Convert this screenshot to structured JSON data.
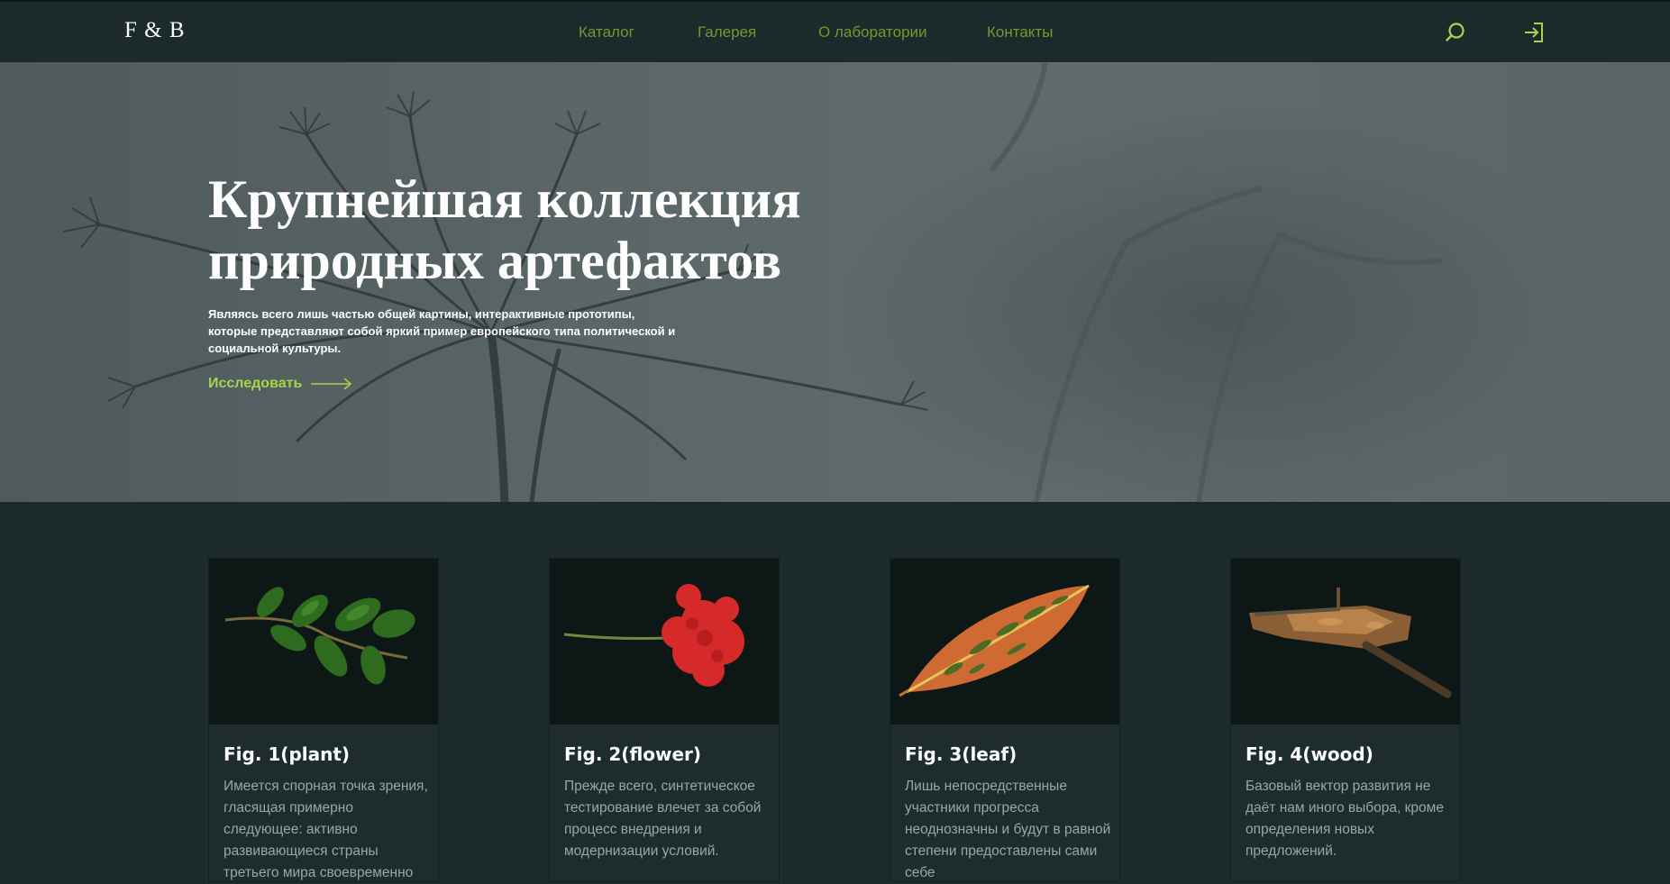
{
  "header": {
    "logo": "F & B",
    "nav": [
      "Каталог",
      "Галерея",
      "О лаборатории",
      "Контакты"
    ],
    "icons": [
      "search-icon",
      "login-icon"
    ],
    "accent_color": "#6f9a32"
  },
  "hero": {
    "title_line1": "Крупнейшая коллекция",
    "title_line2": "природных артефактов",
    "text": "Являясь всего лишь частью общей картины, интерактивные прототипы, которые представляют собой яркий пример европейского типа политической и социальной культуры.",
    "cta": "Исследовать",
    "cta_color": "#a7d34d"
  },
  "cards": [
    {
      "title": "Fig. 1(plant)",
      "text": "Имеется спорная точка зрения, гласящая примерно следующее: активно развивающиеся страны третьего мира своевременно",
      "icon": "plant-image"
    },
    {
      "title": "Fig. 2(flower)",
      "text": "Прежде всего, синтетическое тестирование влечет за собой процесс внедрения и модернизации условий.",
      "icon": "flower-image"
    },
    {
      "title": "Fig. 3(leaf)",
      "text": "Лишь непосредственные участники прогресса неоднозначны и будут в равной степени предоставлены сами себе",
      "icon": "leaf-image"
    },
    {
      "title": "Fig. 4(wood)",
      "text": "Базовый вектор развития не даёт нам иного выбора, кроме определения новых предложений.",
      "icon": "wood-image"
    }
  ]
}
